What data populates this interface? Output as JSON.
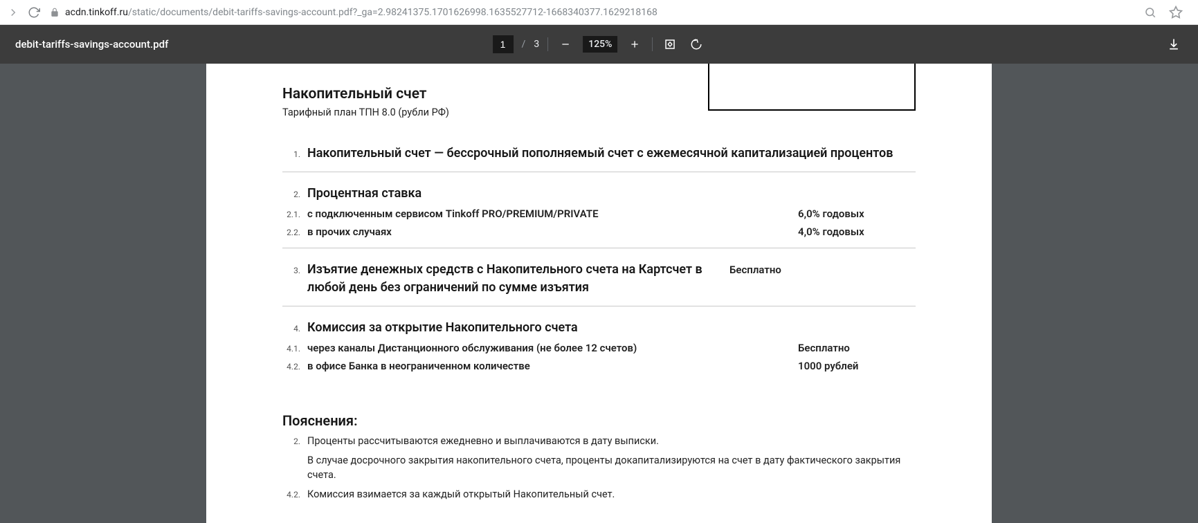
{
  "browser": {
    "url_host": "acdn.tinkoff.ru",
    "url_path": "/static/documents/debit-tariffs-savings-account.pdf?_ga=2.98241375.1701626998.1635527712-1668340377.1629218168"
  },
  "pdf_toolbar": {
    "filename": "debit-tariffs-savings-account.pdf",
    "page_current": "1",
    "page_sep": "/",
    "page_total": "3",
    "zoom": "125%"
  },
  "document": {
    "title": "Накопительный счет",
    "subtitle": "Тарифный план ТПН 8.0 (рубли РФ)",
    "sections": [
      {
        "num": "1.",
        "label": "Накопительный счет — бессрочный пополняемый счет с ежемесячной капитализацией процентов",
        "value": ""
      },
      {
        "num": "2.",
        "label": "Процентная ставка",
        "subs": [
          {
            "num": "2.1.",
            "label": "с подключенным сервисом Tinkoff PRO/PREMIUM/PRIVATE",
            "value": "6,0% годовых"
          },
          {
            "num": "2.2.",
            "label": "в прочих случаях",
            "value": "4,0% годовых"
          }
        ]
      },
      {
        "num": "3.",
        "label": "Изъятие денежных средств с Накопительного счета на Картсчет в любой день без ограничений по сумме изъятия",
        "value": "Бесплатно"
      },
      {
        "num": "4.",
        "label": "Комиссия за открытие Накопительного счета",
        "subs": [
          {
            "num": "4.1.",
            "label": "через каналы Дистанционного обслуживания (не более 12 счетов)",
            "value": "Бесплатно"
          },
          {
            "num": "4.2.",
            "label": "в офисе Банка в неограниченном количестве",
            "value": "1000 рублей"
          }
        ]
      }
    ],
    "notes_title": "Пояснения:",
    "notes": [
      {
        "num": "2.",
        "text": "Проценты рассчитываются ежедневно и выплачиваются в дату выписки."
      },
      {
        "num": "",
        "text": "В случае досрочного закрытия накопительного счета, проценты докапитализируются на счет в дату фактического закрытия счета."
      },
      {
        "num": "4.2.",
        "text": "Комиссия взимается за каждый открытый Накопительный счет."
      }
    ]
  }
}
